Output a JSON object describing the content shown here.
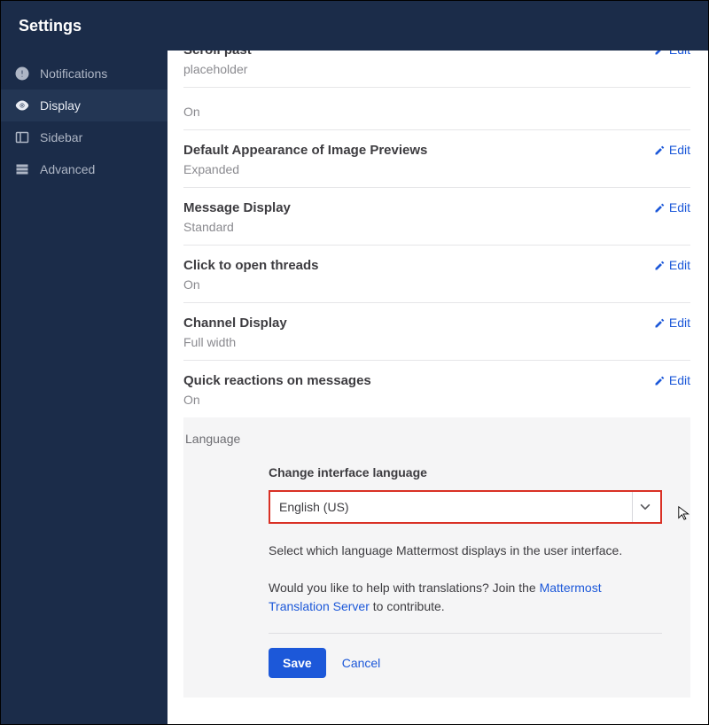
{
  "header": {
    "title": "Settings"
  },
  "sidebar": {
    "items": [
      {
        "label": "Notifications"
      },
      {
        "label": "Display"
      },
      {
        "label": "Sidebar"
      },
      {
        "label": "Advanced"
      }
    ]
  },
  "editLabel": "Edit",
  "filler": {
    "title": "Scroll past",
    "value": "placeholder"
  },
  "rows": [
    {
      "title": "",
      "value": "On"
    },
    {
      "title": "Default Appearance of Image Previews",
      "value": "Expanded"
    },
    {
      "title": "Message Display",
      "value": "Standard"
    },
    {
      "title": "Click to open threads",
      "value": "On"
    },
    {
      "title": "Channel Display",
      "value": "Full width"
    },
    {
      "title": "Quick reactions on messages",
      "value": "On"
    }
  ],
  "language": {
    "section": "Language",
    "fieldLabel": "Change interface language",
    "selected": "English (US)",
    "help1": "Select which language Mattermost displays in the user interface.",
    "help2a": "Would you like to help with translations? Join the ",
    "help2Link": "Mattermost Translation Server",
    "help2b": " to contribute.",
    "save": "Save",
    "cancel": "Cancel"
  }
}
